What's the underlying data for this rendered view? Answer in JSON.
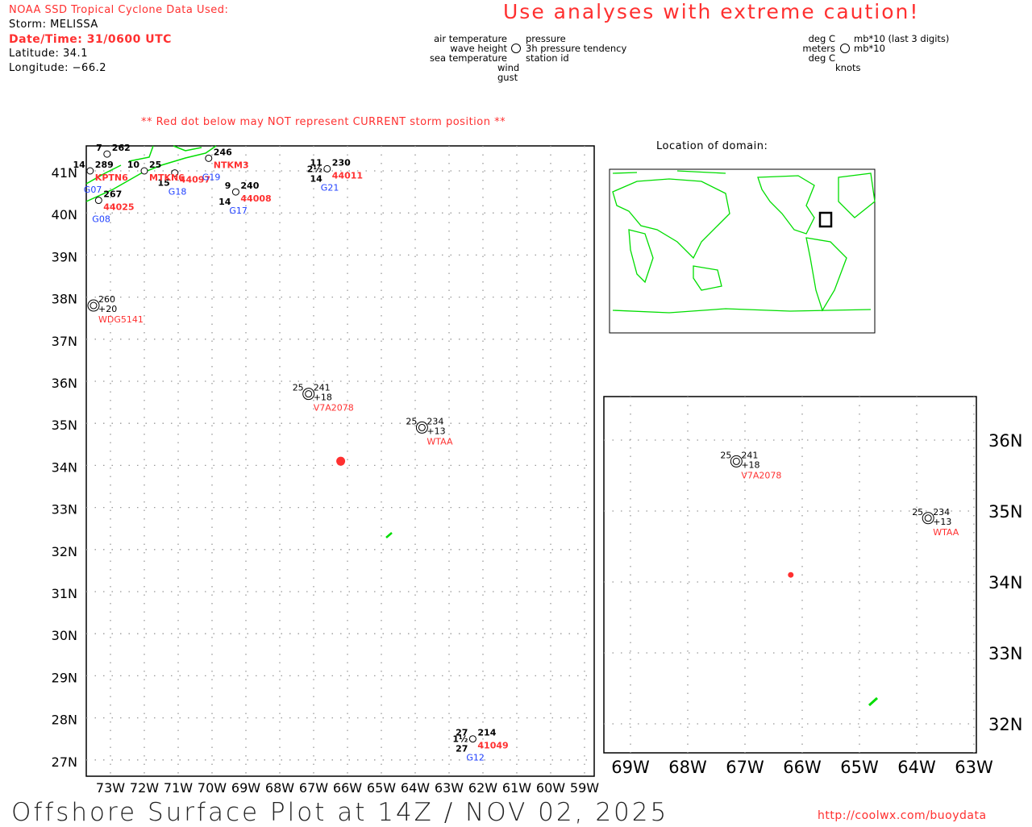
{
  "header": {
    "source": "NOAA SSD Tropical Cyclone Data Used:",
    "storm": "Storm: MELISSA",
    "datetime": "Date/Time: 31/0600 UTC",
    "latitude": "Latitude: 34.1",
    "longitude": "Longitude: −66.2",
    "caution": "Use analyses with extreme caution!",
    "red_dot_note": "** Red dot below may NOT represent CURRENT storm position **"
  },
  "legend": {
    "left": [
      "air temperature",
      "wave height",
      "sea temperature",
      "wind gust"
    ],
    "right": [
      "pressure",
      "3h pressure tendency",
      "station id"
    ],
    "units_left": [
      "deg C",
      "meters",
      "deg C",
      "knots"
    ],
    "units_right": [
      "mb*10 (last 3 digits)",
      "mb*10"
    ]
  },
  "inset_title": "Location of domain:",
  "footer": {
    "title": "Offshore Surface Plot at 14Z / NOV 02, 2025",
    "url": "http://coolwx.com/buoydata"
  },
  "colors": {
    "storm": "#ff3030",
    "coast": "#00dd00",
    "station_id": "#ff3030",
    "buoy_id": "#2040ff"
  },
  "storm": {
    "lat": 34.1,
    "lon": -66.2
  },
  "main_map": {
    "lat_ticks": [
      "41N",
      "40N",
      "39N",
      "38N",
      "37N",
      "36N",
      "35N",
      "34N",
      "33N",
      "32N",
      "31N",
      "30N",
      "29N",
      "28N",
      "27N"
    ],
    "lon_ticks": [
      "73W",
      "72W",
      "71W",
      "70W",
      "69W",
      "68W",
      "67W",
      "66W",
      "65W",
      "64W",
      "63W",
      "62W",
      "61W",
      "60W",
      "59W"
    ]
  },
  "zoom_map": {
    "lat_ticks": [
      "36N",
      "35N",
      "34N",
      "33N",
      "32N"
    ],
    "lon_ticks": [
      "69W",
      "68W",
      "67W",
      "66W",
      "65W",
      "64W",
      "63W"
    ]
  },
  "stations": [
    {
      "id": "WDG5141",
      "lat": 37.8,
      "lon": -73.5,
      "air": "",
      "pressure": "260",
      "tendency": "+20",
      "sea": "",
      "wave": "",
      "gust": "",
      "buoy": ""
    },
    {
      "id": "V7A2078",
      "lat": 35.7,
      "lon": -67.15,
      "air": "25",
      "pressure": "241",
      "tendency": "+18",
      "sea": "",
      "wave": "",
      "gust": "",
      "buoy": ""
    },
    {
      "id": "WTAA",
      "lat": 34.9,
      "lon": -63.8,
      "air": "25",
      "pressure": "234",
      "tendency": "+13",
      "sea": "",
      "wave": "",
      "gust": "",
      "buoy": ""
    },
    {
      "id": "41049",
      "lat": 27.5,
      "lon": -62.3,
      "air": "27",
      "pressure": "214",
      "tendency": "",
      "sea": "27",
      "wave": "1½",
      "gust": "",
      "buoy": "G12"
    },
    {
      "id": "44011",
      "lat": 41.05,
      "lon": -66.6,
      "air": "11",
      "pressure": "230",
      "tendency": "",
      "sea": "14",
      "wave": "2½",
      "gust": "",
      "buoy": "G21"
    },
    {
      "id": "44008",
      "lat": 40.5,
      "lon": -69.3,
      "air": "9",
      "pressure": "240",
      "tendency": "",
      "sea": "14",
      "wave": "",
      "gust": "",
      "buoy": "G17"
    },
    {
      "id": "44025",
      "lat": 40.3,
      "lon": -73.35,
      "air": "",
      "pressure": "267",
      "tendency": "",
      "sea": "",
      "wave": "",
      "gust": "",
      "buoy": "G08"
    },
    {
      "id": "44097",
      "lat": 40.95,
      "lon": -71.1,
      "air": "",
      "pressure": "",
      "tendency": "",
      "sea": "15",
      "wave": "",
      "gust": "",
      "buoy": "G18"
    },
    {
      "id": "MTKN6",
      "lat": 41.0,
      "lon": -72.0,
      "air": "10",
      "pressure": "25",
      "tendency": "",
      "sea": "",
      "wave": "",
      "gust": "",
      "buoy": ""
    },
    {
      "id": "NTKM3",
      "lat": 41.3,
      "lon": -70.1,
      "air": "",
      "pressure": "246",
      "tendency": "",
      "sea": "",
      "wave": "",
      "gust": "",
      "buoy": "G19"
    },
    {
      "id": "KPTN6",
      "lat": 41.0,
      "lon": -73.6,
      "air": "14",
      "pressure": "289",
      "tendency": "",
      "sea": "",
      "wave": "",
      "gust": "",
      "buoy": "G07"
    },
    {
      "id": "",
      "lat": 41.4,
      "lon": -73.1,
      "air": "7",
      "pressure": "262",
      "tendency": "",
      "sea": "",
      "wave": "",
      "gust": "",
      "buoy": ""
    }
  ]
}
